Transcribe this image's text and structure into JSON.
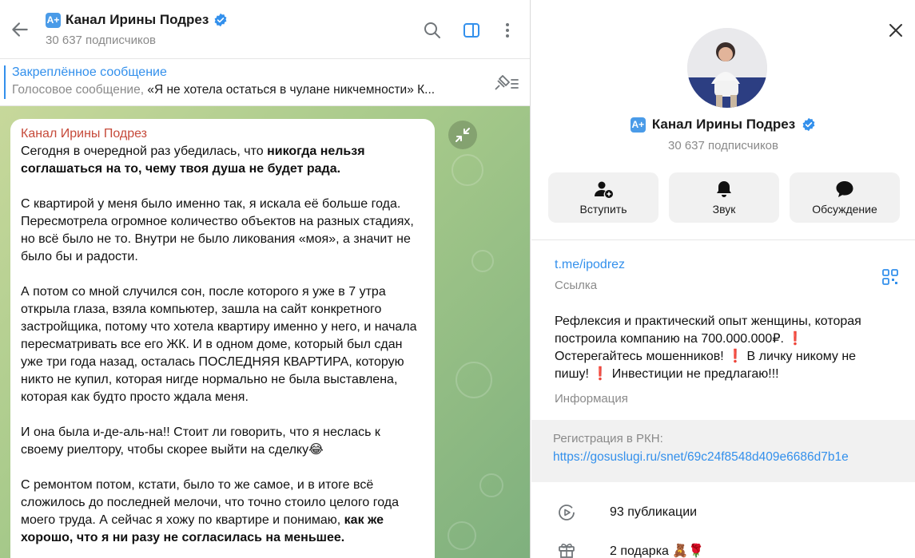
{
  "chat": {
    "title": "Канал Ирины Подрез",
    "badge": "A+",
    "subscribers": "30 637 подписчиков",
    "pinned": {
      "title": "Закреплённое сообщение",
      "type": "Голосовое сообщение,",
      "text": "«Я не хотела остаться в чулане никчемности»  К..."
    },
    "message": {
      "author": "Канал Ирины Подрез",
      "p1_start": "Сегодня в очередной раз убедилась, что ",
      "p1_bold": "никогда нельзя соглашаться на то, чему твоя душа не будет рада.",
      "p2": "С квартирой  у меня было именно так, я искала её больше года. Пересмотрела огромное количество объектов на разных стадиях, но всё было не то. Внутри не было ликования «моя», а значит не было бы и радости.",
      "p3": "А потом со мной случился сон, после которого я уже в 7 утра открыла глаза, взяла компьютер, зашла на сайт конкретного застройщика, потому что хотела квартиру именно у него, и начала пересматривать все его ЖК. И в одном доме, который был сдан уже три года назад, осталась ПОСЛЕДНЯЯ КВАРТИРА, которую никто не купил, которая нигде нормально не была выставлена, которая как будто просто ждала меня.",
      "p4": "И она была и-де-аль-на!! Стоит ли говорить, что я неслась к своему риелтору, чтобы скорее выйти на сделку😂",
      "p5_start": "С ремонтом потом, кстати, было то же самое, и в итоге всё сложилось до последней мелочи, что точно стоило целого года моего труда. А сейчас я хожу по квартире и понимаю, ",
      "p5_bold": "как же хорошо, что я ни разу не согласилась на меньшее."
    }
  },
  "info": {
    "name": "Канал Ирины Подрез",
    "badge": "A+",
    "subscribers": "30 637 подписчиков",
    "actions": {
      "join": "Вступить",
      "sound": "Звук",
      "discussion": "Обсуждение"
    },
    "link": "t.me/ipodrez",
    "link_caption": "Ссылка",
    "description": "Рефлексия и практический опыт женщины, которая построила компанию на 700.000.000₽. ❗️ Остерегайтесь мошенников! ❗️ В личку никому не пишу! ❗️ Инвестиции не предлагаю!!!",
    "description_caption": "Информация",
    "rkn_label": "Регистрация в РКН:",
    "rkn_link": "https://gosuslugi.ru/snet/69c24f8548d409e6686d7b1e",
    "publications": "93 публикации",
    "gifts": "2 подарка 🧸🌹"
  },
  "colors": {
    "accent": "#3390ec",
    "author": "#c64a3a",
    "muted": "#8a8a8a"
  }
}
